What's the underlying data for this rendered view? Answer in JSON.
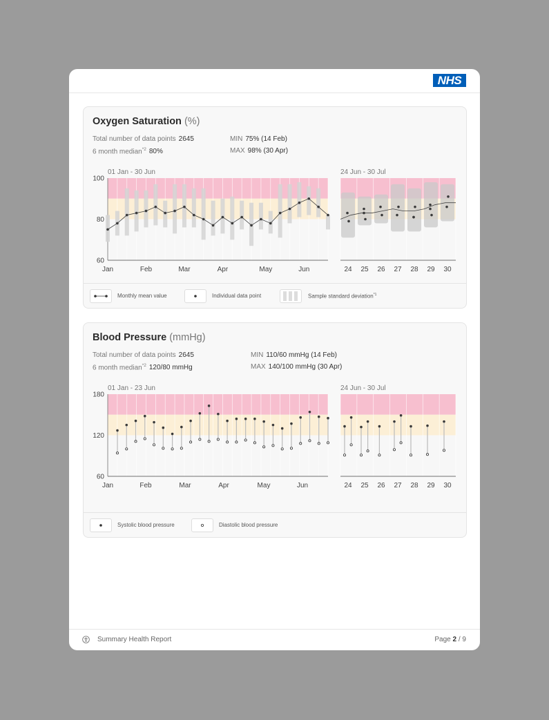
{
  "header": {
    "logo_text": "NHS"
  },
  "oxygen": {
    "title": "Oxygen Saturation",
    "unit": "(%)",
    "total_label": "Total number of data points",
    "total_value": "2645",
    "median_label": "6 month median",
    "median_sup": "*2",
    "median_value": "80%",
    "min_label": "MIN",
    "min_value": "75% (14 Feb)",
    "max_label": "MAX",
    "max_value": "98% (30 Apr)",
    "legend": {
      "mean": "Monthly mean value",
      "point": "Individual data point",
      "sd": "Sample standard deviation",
      "sd_sup": "*1"
    }
  },
  "pressure": {
    "title": "Blood Pressure",
    "unit": "(mmHg)",
    "total_label": "Total number of data points",
    "total_value": "2645",
    "median_label": "6 month median",
    "median_sup": "*2",
    "median_value": "120/80 mmHg",
    "min_label": "MIN",
    "min_value": "110/60 mmHg (14 Feb)",
    "max_label": "MAX",
    "max_value": "140/100 mmHg (30 Apr)",
    "legend": {
      "systolic": "Systolic blood pressure",
      "diastolic": "Diastolic blood pressure"
    }
  },
  "footer": {
    "title": "Summary Health Report",
    "page_label": "Page",
    "page_current": "2",
    "page_total": "/ 9"
  },
  "colors": {
    "danger_band": "#f7bfcf",
    "warn_band": "#fcefd6",
    "bar": "#d3d3d3",
    "point": "#3a3a3a",
    "nhs_blue": "#005eb8"
  },
  "chart_data": [
    {
      "type": "line",
      "name": "oxygen-6-month",
      "range_label": "01 Jan - 30 Jun",
      "ylim": [
        60,
        100
      ],
      "yticks": [
        100,
        80,
        60
      ],
      "xticks": [
        "Jan",
        "Feb",
        "Mar",
        "Apr",
        "May",
        "Jun"
      ],
      "bands": [
        {
          "from": 90,
          "to": 100,
          "color": "danger"
        },
        {
          "from": 80,
          "to": 90,
          "color": "warn"
        }
      ],
      "mean": [
        75,
        78,
        82,
        83,
        84,
        86,
        83,
        84,
        86,
        82,
        80,
        77,
        81,
        78,
        81,
        77,
        80,
        78,
        83,
        85,
        88,
        90,
        86,
        82
      ],
      "sd_low": [
        69,
        72,
        72,
        74,
        76,
        77,
        76,
        73,
        76,
        76,
        70,
        72,
        73,
        70,
        75,
        67,
        75,
        73,
        71,
        78,
        81,
        82,
        81,
        75
      ],
      "sd_high": [
        82,
        84,
        95,
        94,
        94,
        97,
        89,
        97,
        97,
        95,
        95,
        89,
        90,
        91,
        89,
        88,
        88,
        84,
        97,
        97,
        98,
        96,
        95,
        82
      ]
    },
    {
      "type": "line",
      "name": "oxygen-week",
      "range_label": "24 Jun - 30 Jul",
      "ylim": [
        60,
        100
      ],
      "xticks": [
        "24",
        "25",
        "26",
        "27",
        "28",
        "29",
        "30"
      ],
      "bands": [
        {
          "from": 90,
          "to": 100,
          "color": "danger"
        },
        {
          "from": 80,
          "to": 90,
          "color": "warn"
        }
      ],
      "mean_curve": [
        80,
        82,
        83,
        83,
        84,
        85,
        84,
        84,
        85,
        87,
        88,
        88
      ],
      "points": [
        [
          24,
          83
        ],
        [
          24,
          79
        ],
        [
          25,
          83
        ],
        [
          25,
          80
        ],
        [
          25,
          85
        ],
        [
          26,
          86
        ],
        [
          26,
          82
        ],
        [
          27,
          82
        ],
        [
          27,
          86
        ],
        [
          28,
          81
        ],
        [
          28,
          86
        ],
        [
          28,
          81
        ],
        [
          29,
          87
        ],
        [
          29,
          82
        ],
        [
          29,
          85
        ],
        [
          30,
          86
        ],
        [
          30,
          91
        ]
      ],
      "sd": [
        [
          24,
          71,
          93
        ],
        [
          25,
          77,
          91
        ],
        [
          26,
          78,
          92
        ],
        [
          27,
          74,
          97
        ],
        [
          28,
          74,
          95
        ],
        [
          29,
          76,
          98
        ],
        [
          30,
          79,
          97
        ]
      ]
    },
    {
      "type": "bar",
      "name": "pressure-6-month",
      "range_label": "01 Jan - 23 Jun",
      "ylim": [
        60,
        180
      ],
      "yticks": [
        180,
        120,
        60
      ],
      "xticks": [
        "Jan",
        "Feb",
        "Mar",
        "Apr",
        "May",
        "Jun"
      ],
      "bands": [
        {
          "from": 150,
          "to": 180,
          "color": "danger"
        },
        {
          "from": 120,
          "to": 150,
          "color": "warn"
        }
      ],
      "systolic": [
        127,
        135,
        141,
        148,
        139,
        131,
        122,
        132,
        141,
        152,
        163,
        151,
        141,
        144,
        144,
        144,
        140,
        135,
        130,
        137,
        146,
        154,
        147,
        145
      ],
      "diastolic": [
        94,
        100,
        111,
        115,
        106,
        101,
        100,
        101,
        110,
        114,
        111,
        114,
        110,
        110,
        113,
        109,
        103,
        105,
        100,
        101,
        108,
        112,
        108,
        109
      ]
    },
    {
      "type": "bar",
      "name": "pressure-week",
      "range_label": "24 Jun - 30 Jul",
      "ylim": [
        60,
        180
      ],
      "xticks": [
        "24",
        "25",
        "26",
        "27",
        "28",
        "29",
        "30"
      ],
      "bands": [
        {
          "from": 150,
          "to": 180,
          "color": "danger"
        },
        {
          "from": 120,
          "to": 150,
          "color": "warn"
        }
      ],
      "systolic": [
        [
          24.0,
          133
        ],
        [
          24.4,
          146
        ],
        [
          25.0,
          132
        ],
        [
          25.4,
          140
        ],
        [
          26.1,
          133
        ],
        [
          27.0,
          140
        ],
        [
          27.4,
          149
        ],
        [
          28.0,
          133
        ],
        [
          29.0,
          134
        ],
        [
          30.0,
          140
        ]
      ],
      "diastolic": [
        [
          24.0,
          91
        ],
        [
          24.4,
          106
        ],
        [
          25.0,
          91
        ],
        [
          25.4,
          97
        ],
        [
          26.1,
          91
        ],
        [
          27.0,
          99
        ],
        [
          27.4,
          109
        ],
        [
          28.0,
          91
        ],
        [
          29.0,
          92
        ],
        [
          30.0,
          98
        ]
      ]
    }
  ]
}
